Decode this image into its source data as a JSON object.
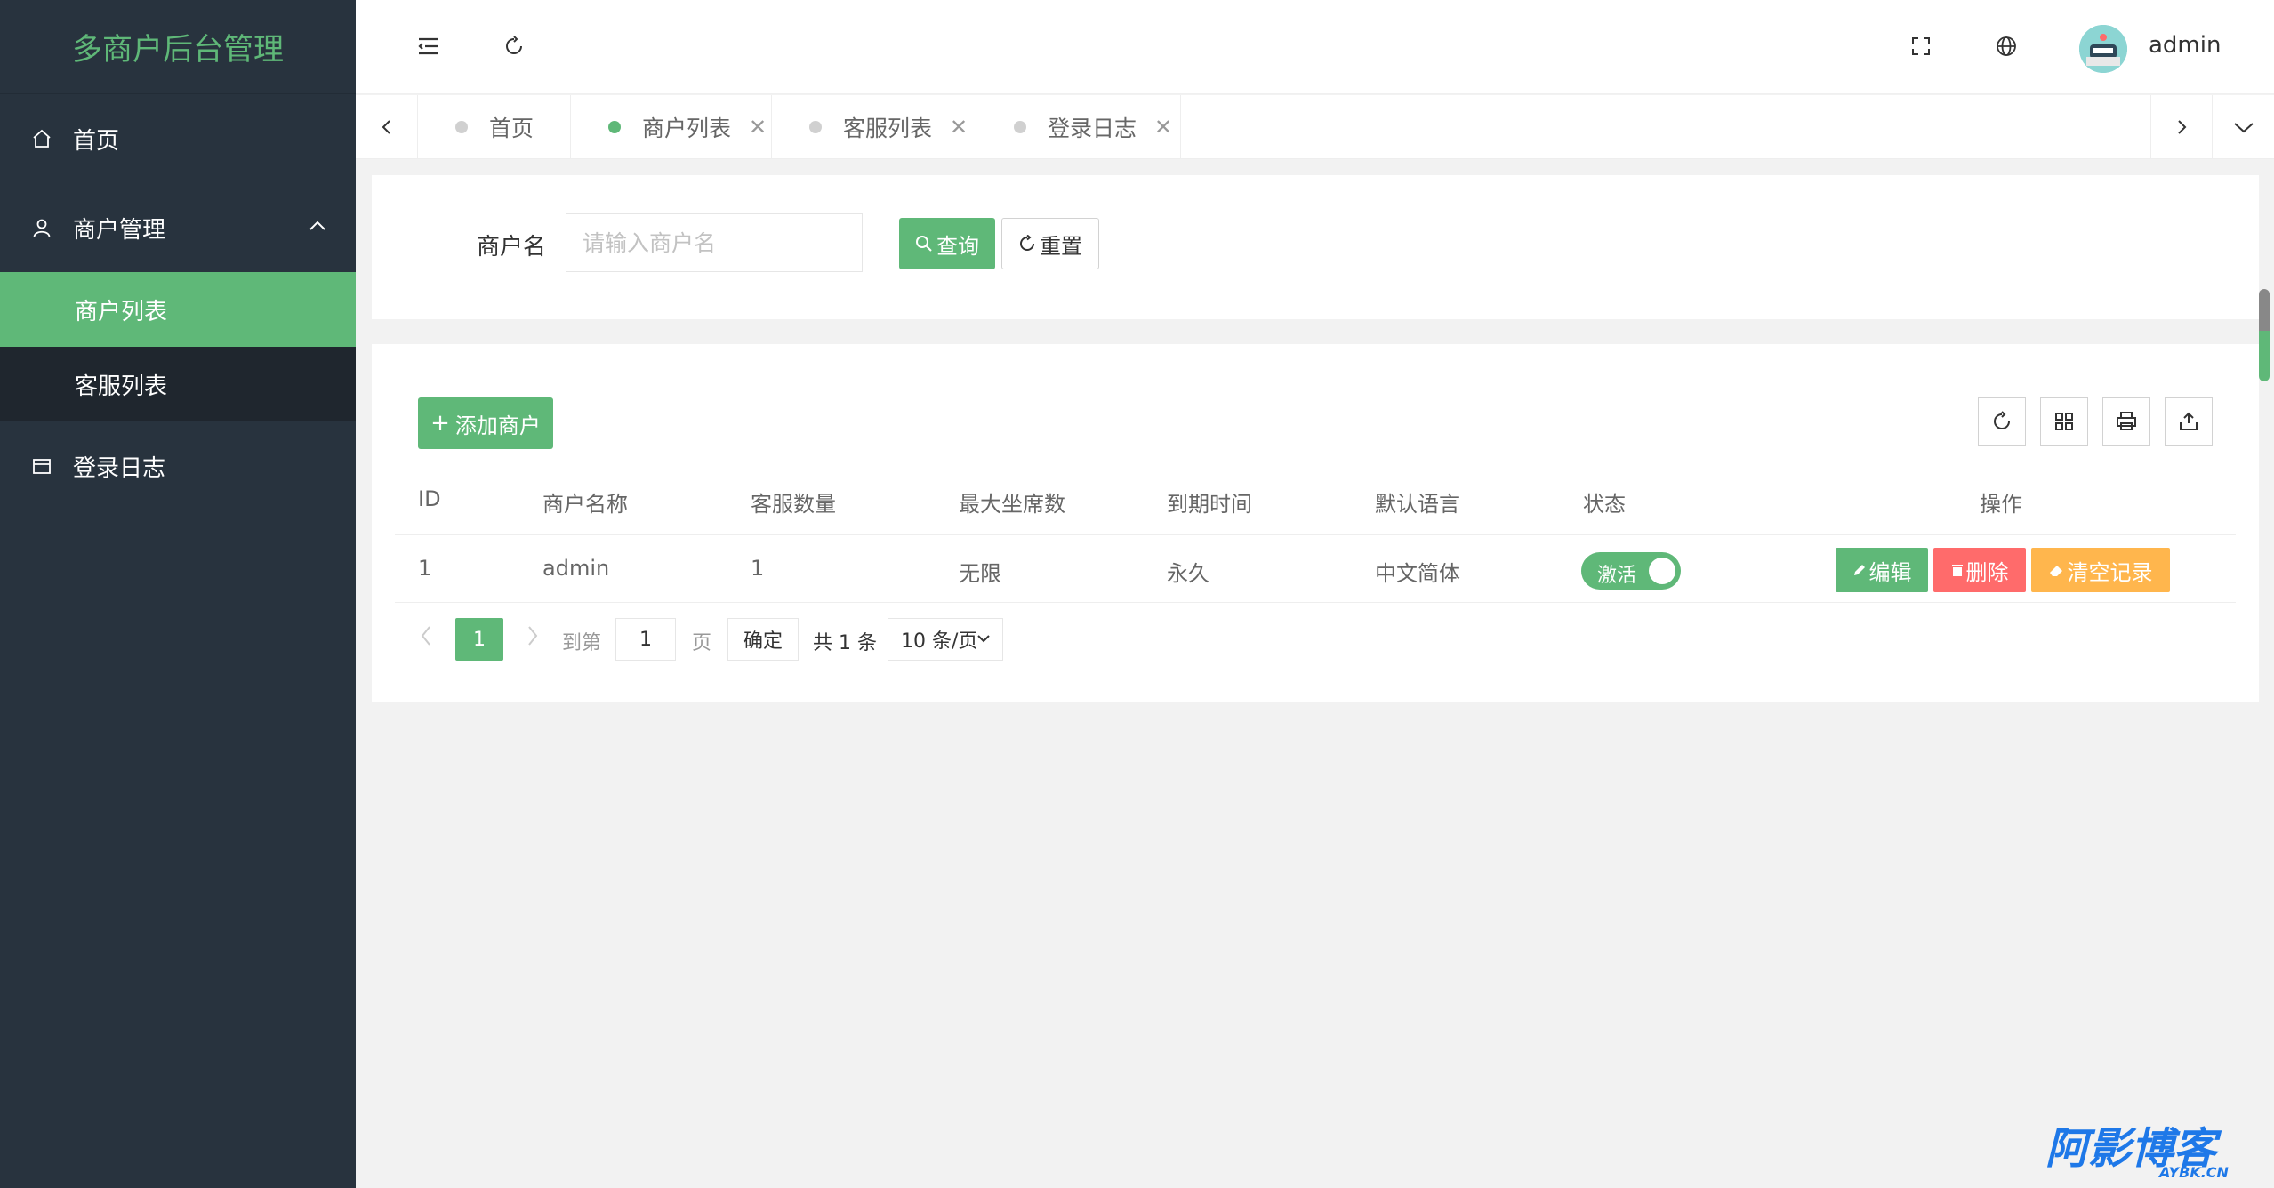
{
  "sidebar": {
    "logo": "多商户后台管理",
    "items": [
      {
        "label": "首页"
      },
      {
        "label": "商户管理",
        "children": [
          {
            "label": "商户列表",
            "active": true
          },
          {
            "label": "客服列表"
          }
        ]
      },
      {
        "label": "登录日志"
      }
    ]
  },
  "header": {
    "user": "admin"
  },
  "tabs": [
    {
      "label": "首页"
    },
    {
      "label": "商户列表",
      "active": true
    },
    {
      "label": "客服列表"
    },
    {
      "label": "登录日志"
    }
  ],
  "search": {
    "label": "商户名",
    "placeholder": "请输入商户名",
    "query_label": "查询",
    "reset_label": "重置"
  },
  "table": {
    "add_label": "添加商户",
    "columns": [
      "ID",
      "商户名称",
      "客服数量",
      "最大坐席数",
      "到期时间",
      "默认语言",
      "状态",
      "操作"
    ],
    "rows": [
      {
        "id": "1",
        "name": "admin",
        "staff": "1",
        "max_seats": "无限",
        "expire": "永久",
        "lang": "中文简体",
        "status": "激活"
      }
    ],
    "actions": {
      "edit": "编辑",
      "delete": "删除",
      "clear": "清空记录"
    }
  },
  "pagination": {
    "current": "1",
    "goto_prefix": "到第",
    "goto_value": "1",
    "goto_suffix": "页",
    "confirm": "确定",
    "total": "共 1 条",
    "page_size": "10 条/页"
  },
  "colors": {
    "accent": "#5fb878",
    "sidebar": "#28333e",
    "danger": "#ff5722",
    "warning": "#ffb800"
  },
  "watermark": {
    "brand": "阿影博客",
    "domain": "AYBK.CN"
  }
}
